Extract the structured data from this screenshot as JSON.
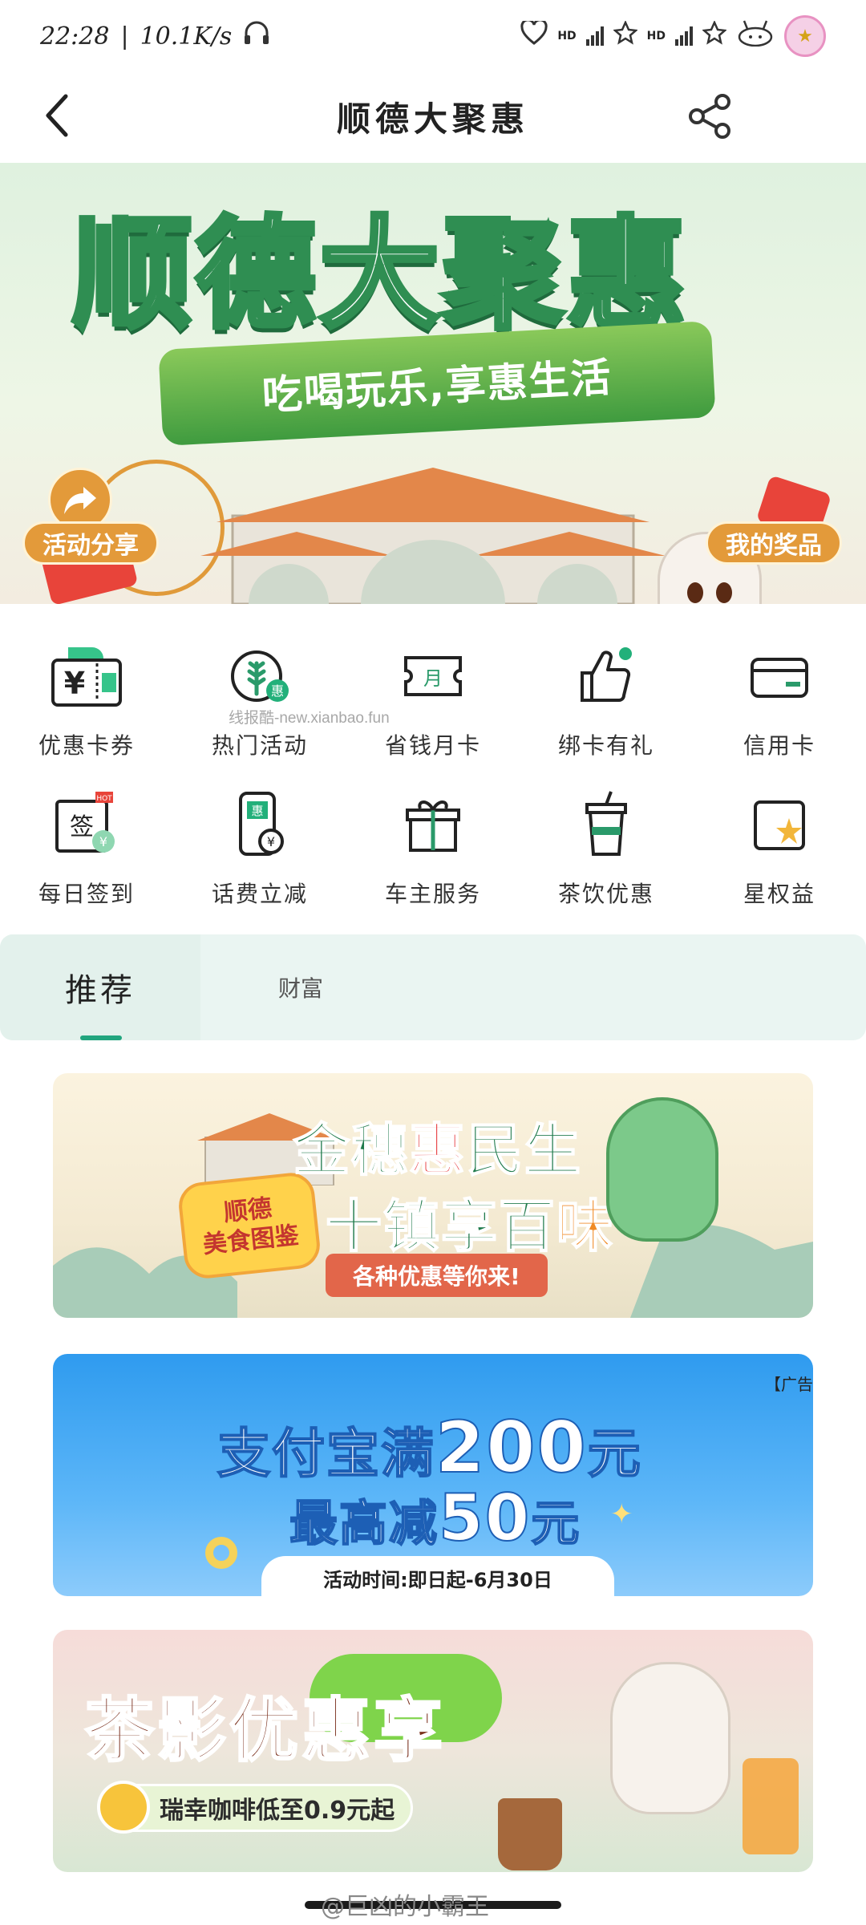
{
  "status_bar": {
    "time": "22:28",
    "speed": "10.1K/s",
    "hd1": "HD",
    "hd2": "HD"
  },
  "nav": {
    "title": "顺德大聚惠"
  },
  "hero": {
    "headline": "顺德大聚惠",
    "slogan": "吃喝玩乐,享惠生活",
    "share_label": "活动分享",
    "prize_label": "我的奖品"
  },
  "watermark": "线报酷-new.xianbao.fun",
  "grid": [
    {
      "label": "优惠卡券",
      "icon": "coupon-icon"
    },
    {
      "label": "热门活动",
      "icon": "wheat-badge-icon"
    },
    {
      "label": "省钱月卡",
      "icon": "monthly-card-icon"
    },
    {
      "label": "绑卡有礼",
      "icon": "thumbs-up-icon"
    },
    {
      "label": "信用卡",
      "icon": "credit-card-icon"
    },
    {
      "label": "每日签到",
      "icon": "checkin-icon"
    },
    {
      "label": "话费立减",
      "icon": "phone-bill-icon"
    },
    {
      "label": "车主服务",
      "icon": "gift-icon"
    },
    {
      "label": "茶饮优惠",
      "icon": "drink-cup-icon"
    },
    {
      "label": "星权益",
      "icon": "star-card-icon"
    }
  ],
  "tabs": [
    {
      "label": "推荐",
      "active": true
    },
    {
      "label": "财富",
      "active": false
    }
  ],
  "promo1": {
    "line1_a": "金穗",
    "line1_b": "惠",
    "line1_c": "民生",
    "line2_a": "十镇享百",
    "line2_b": "味",
    "badge_l1": "顺德",
    "badge_l2": "美食图鉴",
    "pill": "各种优惠等你来!"
  },
  "promo2": {
    "ad_tag": "【广告",
    "line1_a": "支付宝满",
    "line1_b": "200",
    "line1_c": "元",
    "line2_a": "最高减",
    "line2_b": "50",
    "line2_c": "元",
    "time": "活动时间:即日起-6月30日"
  },
  "promo3": {
    "title": "茶影优惠享",
    "subtitle": "瑞幸咖啡低至0.9元起"
  },
  "footer": {
    "weibo": "@巨凶的小霸王"
  },
  "colors": {
    "accent": "#21a57e",
    "brand_green": "#2f8e52",
    "tab_bg": "#eaf5f2"
  }
}
